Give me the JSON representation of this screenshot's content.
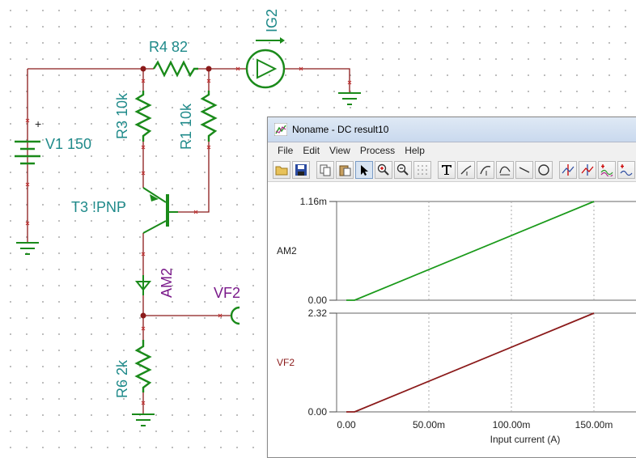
{
  "schematic": {
    "r4_label": "R4 82",
    "ig2_label": "IG2",
    "r3_label": "R3 10k",
    "r1_label": "R1 10k",
    "v1_label": "V1 150",
    "v1_plus": "+",
    "t3_label": "T3 !PNP",
    "am2_label": "AM2",
    "vf2_label": "VF2",
    "r6_label": "R6 2k"
  },
  "window": {
    "title": "Noname - DC result10",
    "menu": [
      "File",
      "Edit",
      "View",
      "Process",
      "Help"
    ],
    "toolbar_icons": [
      "open-folder-icon",
      "save-icon",
      "copy-icon",
      "paste-icon",
      "pointer-icon",
      "zoom-in-icon",
      "zoom-100-icon",
      "grid-icon",
      "text-icon",
      "marker-icon",
      "curve-marker-icon",
      "bezier-icon",
      "line-icon",
      "ellipse-icon",
      "cursor-a-icon",
      "cursor-b-icon",
      "waveform-icon",
      "waveform-2-icon"
    ]
  },
  "colors": {
    "wire": "#8b1a1a",
    "component": "#1a8a1a",
    "label": "#1f8a8a",
    "label_purple": "#7a1a8a",
    "am2_trace": "#1a9a1a",
    "vf2_trace": "#8b1a1a"
  },
  "chart_data": [
    {
      "type": "line",
      "series": [
        {
          "name": "AM2",
          "x": [
            0,
            0.005,
            0.15
          ],
          "y": [
            0,
            0,
            0.00116
          ]
        }
      ],
      "ylim": [
        0,
        0.00116
      ],
      "xlim": [
        0,
        0.15
      ],
      "y_tick_labels": [
        "0.00",
        "1.16m"
      ],
      "ylabel": "AM2",
      "grid": true
    },
    {
      "type": "line",
      "series": [
        {
          "name": "VF2",
          "x": [
            0,
            0.005,
            0.15
          ],
          "y": [
            0,
            0,
            2.32
          ]
        }
      ],
      "ylim": [
        0,
        2.32
      ],
      "xlim": [
        0,
        0.15
      ],
      "y_tick_labels": [
        "0.00",
        "2.32"
      ],
      "x_tick_labels": [
        "0.00",
        "50.00m",
        "100.00m",
        "150.00m"
      ],
      "x_tick_values": [
        0,
        0.05,
        0.1,
        0.15
      ],
      "ylabel": "VF2",
      "xlabel": "Input current (A)",
      "grid": true
    }
  ]
}
